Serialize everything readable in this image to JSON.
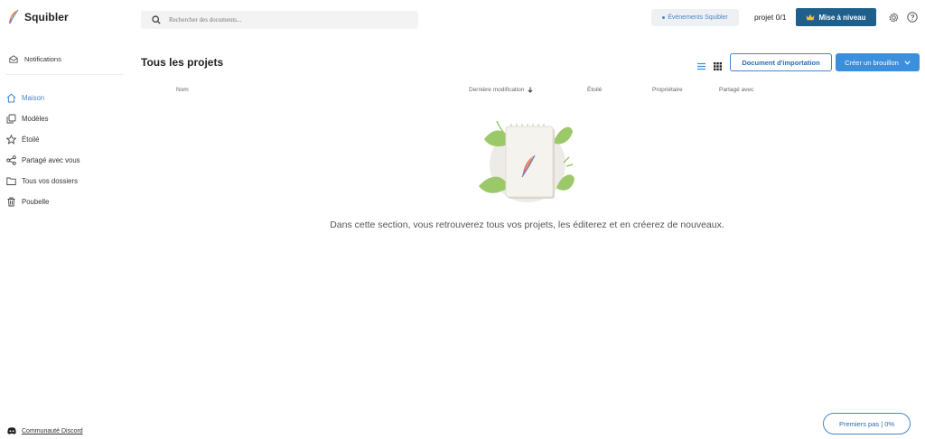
{
  "app": {
    "name": "Squibler"
  },
  "search": {
    "placeholder": "Rechercher des documents..."
  },
  "header": {
    "events_label": "Événements Squibler",
    "project_count": "projet 0/1",
    "upgrade_label": "Mise à niveau"
  },
  "sidebar": {
    "notifications": "Notifications",
    "items": [
      {
        "label": "Maison",
        "icon": "home-icon",
        "active": true
      },
      {
        "label": "Modèles",
        "icon": "templates-icon"
      },
      {
        "label": "Étoilé",
        "icon": "star-icon"
      },
      {
        "label": "Partagé avec vous",
        "icon": "share-icon"
      },
      {
        "label": "Tous vos dossiers",
        "icon": "folder-icon"
      },
      {
        "label": "Poubelle",
        "icon": "trash-icon"
      }
    ],
    "discord": "Communauté Discord"
  },
  "main": {
    "title": "Tous les projets",
    "import_label": "Document d'importation",
    "create_label": "Créer un brouillon",
    "columns": {
      "name": "Nom",
      "modified": "Dernière modification",
      "starred": "Étoilé",
      "owner": "Propriétaire",
      "shared": "Partagé avec"
    },
    "empty_message": "Dans cette section, vous retrouverez tous vos projets, les éditerez et en créerez de nouveaux."
  },
  "footer": {
    "first_steps": "Premiers pas |",
    "progress": "0%"
  },
  "colors": {
    "accent": "#3c8fdc",
    "upgrade": "#1f5f8b",
    "active_nav": "#4a84c8"
  }
}
